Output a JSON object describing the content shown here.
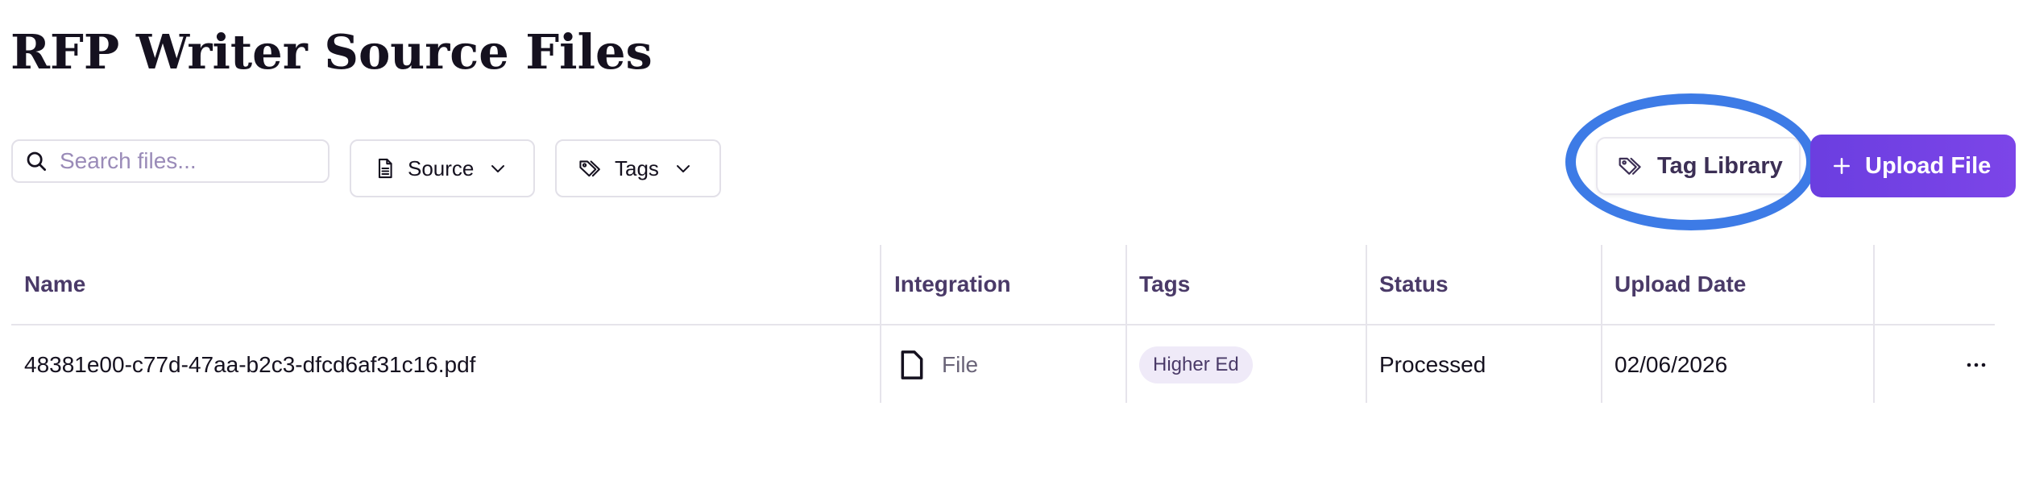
{
  "page": {
    "title": "RFP Writer Source Files"
  },
  "toolbar": {
    "search_placeholder": "Search files...",
    "source_label": "Source",
    "tags_label": "Tags",
    "tag_library_label": "Tag Library",
    "upload_label": "Upload File"
  },
  "table": {
    "headers": [
      "Name",
      "Integration",
      "Tags",
      "Status",
      "Upload Date"
    ],
    "rows": [
      {
        "name": "48381e00-c77d-47aa-b2c3-dfcd6af31c16.pdf",
        "integration": "File",
        "tag": "Higher Ed",
        "status": "Processed",
        "upload_date": "02/06/2026"
      }
    ]
  },
  "colors": {
    "accent": "#7340e6",
    "highlight": "#3d7be6",
    "header_text": "#4a3a68",
    "tag_bg": "#efeaf8"
  },
  "icons": {
    "search": "search-icon",
    "source": "document-icon",
    "tags": "tag-icon",
    "chevron": "chevron-down-icon",
    "plus": "plus-icon",
    "file": "file-icon",
    "more": "more-horizontal-icon"
  }
}
